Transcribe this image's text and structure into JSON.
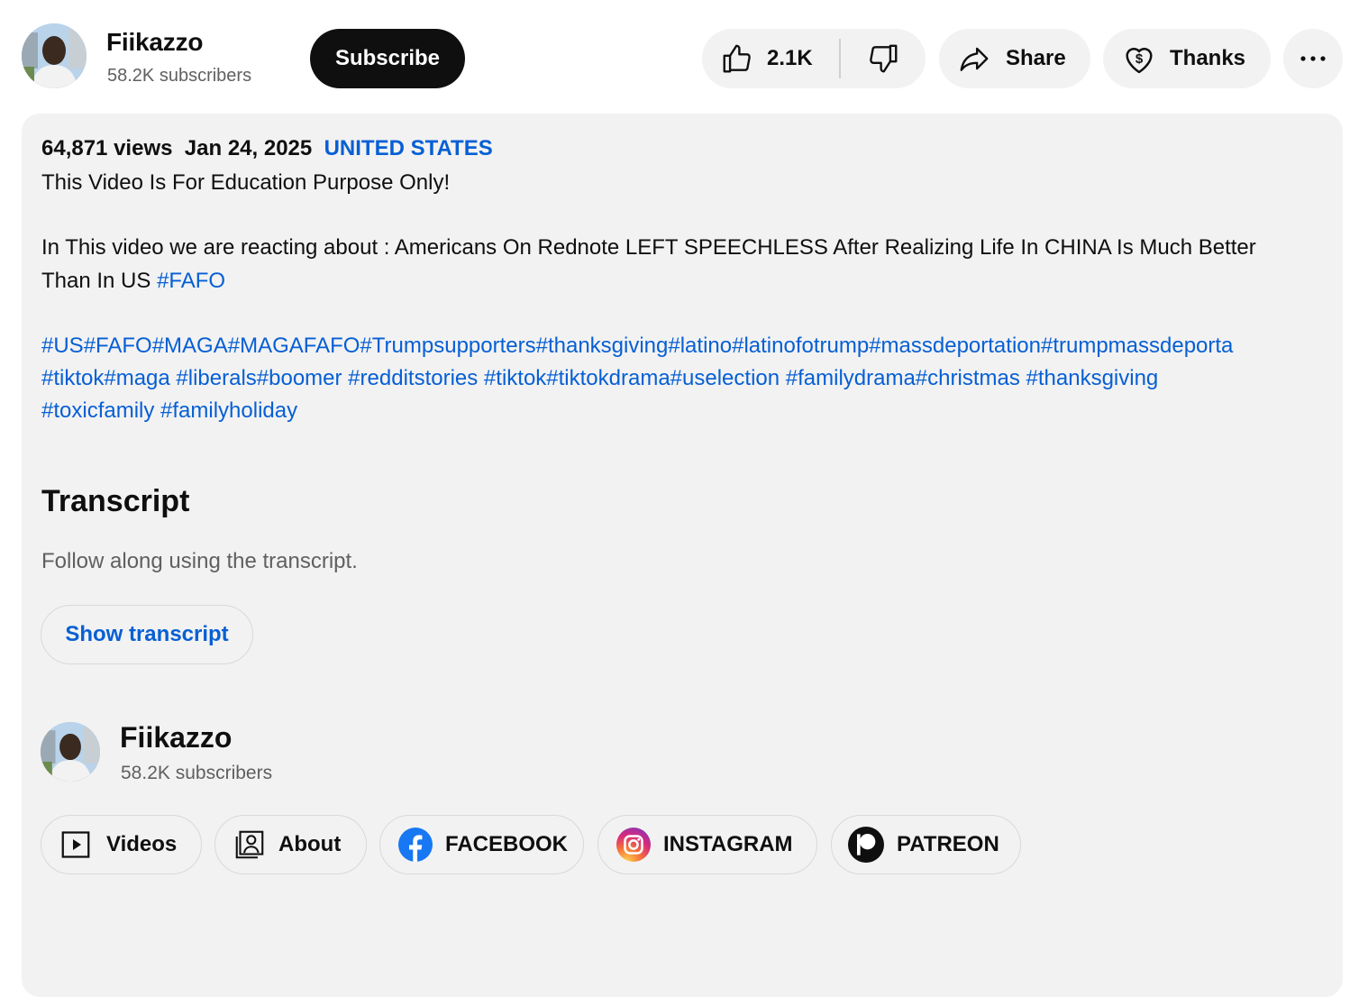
{
  "channel": {
    "name": "Fiikazzo",
    "subscribers": "58.2K subscribers"
  },
  "actions": {
    "subscribe_label": "Subscribe",
    "like_count": "2.1K",
    "share_label": "Share",
    "thanks_label": "Thanks"
  },
  "description": {
    "views": "64,871 views",
    "date": "Jan 24, 2025",
    "location": "UNITED STATES",
    "line1": "This Video Is For Education Purpose Only!",
    "line2": "In This video we are reacting about : Americans On Rednote LEFT SPEECHLESS After Realizing Life In CHINA Is Much Better",
    "line3_text": "Than In US ",
    "line3_tag": "#FAFO",
    "hashtags_line1": "#US#FAFO#MAGA#MAGAFAFO#Trumpsupporters#thanksgiving#latino#latinofotrump#massdeportation#trumpmassdeporta",
    "hashtags_line2": "#tiktok#maga #liberals#boomer #redditstories #tiktok#tiktokdrama#uselection #familydrama#christmas #thanksgiving",
    "hashtags_line3": "#toxicfamily #familyholiday"
  },
  "transcript": {
    "title": "Transcript",
    "subtitle": "Follow along using the transcript.",
    "button_label": "Show transcript"
  },
  "channel_card": {
    "name": "Fiikazzo",
    "subscribers": "58.2K subscribers"
  },
  "links": [
    {
      "label": "Videos",
      "icon": "play-icon"
    },
    {
      "label": "About",
      "icon": "portrait-icon"
    },
    {
      "label": "FACEBOOK",
      "icon": "facebook-icon"
    },
    {
      "label": "INSTAGRAM",
      "icon": "instagram-icon"
    },
    {
      "label": "PATREON",
      "icon": "patreon-icon"
    }
  ],
  "colors": {
    "link_blue": "#065fd4",
    "pill_bg": "#f2f2f2",
    "subscribe_bg": "#0f0f0f"
  }
}
